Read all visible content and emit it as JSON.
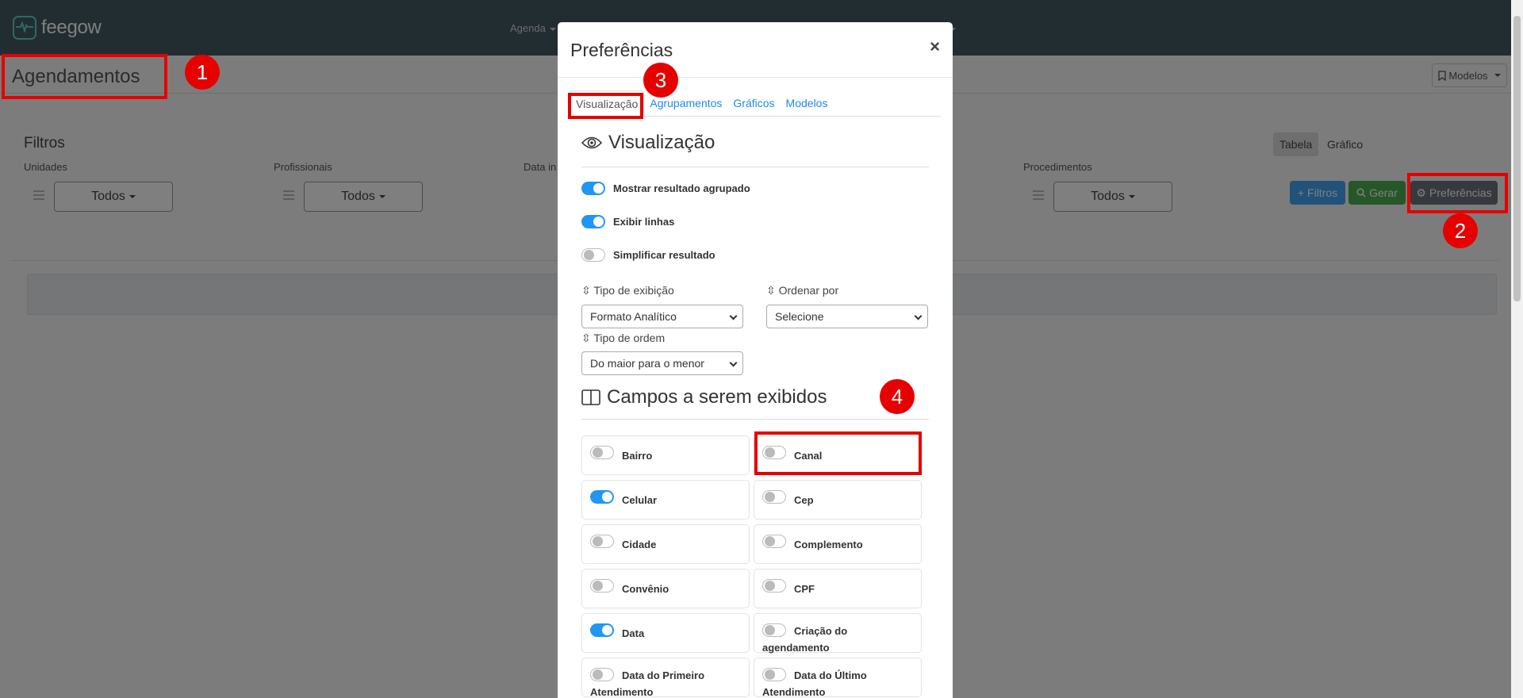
{
  "app": {
    "logo_text": "feegow"
  },
  "nav": {
    "agenda": "Agenda"
  },
  "page": {
    "title": "Agendamentos",
    "modelos": "Modelos"
  },
  "filters": {
    "title": "Filtros",
    "unidades": "Unidades",
    "profissionais": "Profissionais",
    "data_label": "Data in",
    "procedimentos": "Procedimentos",
    "todos": "Todos"
  },
  "view_toggle": {
    "tabela": "Tabela",
    "grafico": "Gráfico"
  },
  "actions": {
    "filtros": "Filtros",
    "gerar": "Gerar",
    "preferencias": "Preferências"
  },
  "modal": {
    "title": "Preferências",
    "close": "×",
    "tabs": [
      "Visualização",
      "Agrupamentos",
      "Gráficos",
      "Modelos"
    ],
    "section1": "Visualização",
    "toggles": [
      {
        "label": "Mostrar resultado agrupado",
        "on": true
      },
      {
        "label": "Exibir linhas",
        "on": true
      },
      {
        "label": "Simplificar resultado",
        "on": false
      }
    ],
    "tipo_exibicao": {
      "label": "Tipo de exibição",
      "value": "Formato Analítico"
    },
    "ordenar_por": {
      "label": "Ordenar por",
      "value": "Selecione"
    },
    "tipo_ordem": {
      "label": "Tipo de ordem",
      "value": "Do maior para o menor"
    },
    "section2": "Campos a serem exibidos",
    "fields": [
      {
        "label": "Bairro",
        "on": false
      },
      {
        "label": "Canal",
        "on": false
      },
      {
        "label": "Celular",
        "on": true
      },
      {
        "label": "Cep",
        "on": false
      },
      {
        "label": "Cidade",
        "on": false
      },
      {
        "label": "Complemento",
        "on": false
      },
      {
        "label": "Convênio",
        "on": false
      },
      {
        "label": "CPF",
        "on": false
      },
      {
        "label": "Data",
        "on": true
      },
      {
        "label": "Criação do agendamento",
        "on": false
      },
      {
        "label": "Data do Primeiro Atendimento",
        "on": false
      },
      {
        "label": "Data do Último Atendimento",
        "on": false
      }
    ]
  },
  "annotations": [
    "1",
    "2",
    "3",
    "4"
  ],
  "colors": {
    "nav": "#455a64",
    "accent": "#2196f3",
    "annotation": "#e60000",
    "gerar": "#4caf50",
    "filtros": "#42a5f5"
  }
}
